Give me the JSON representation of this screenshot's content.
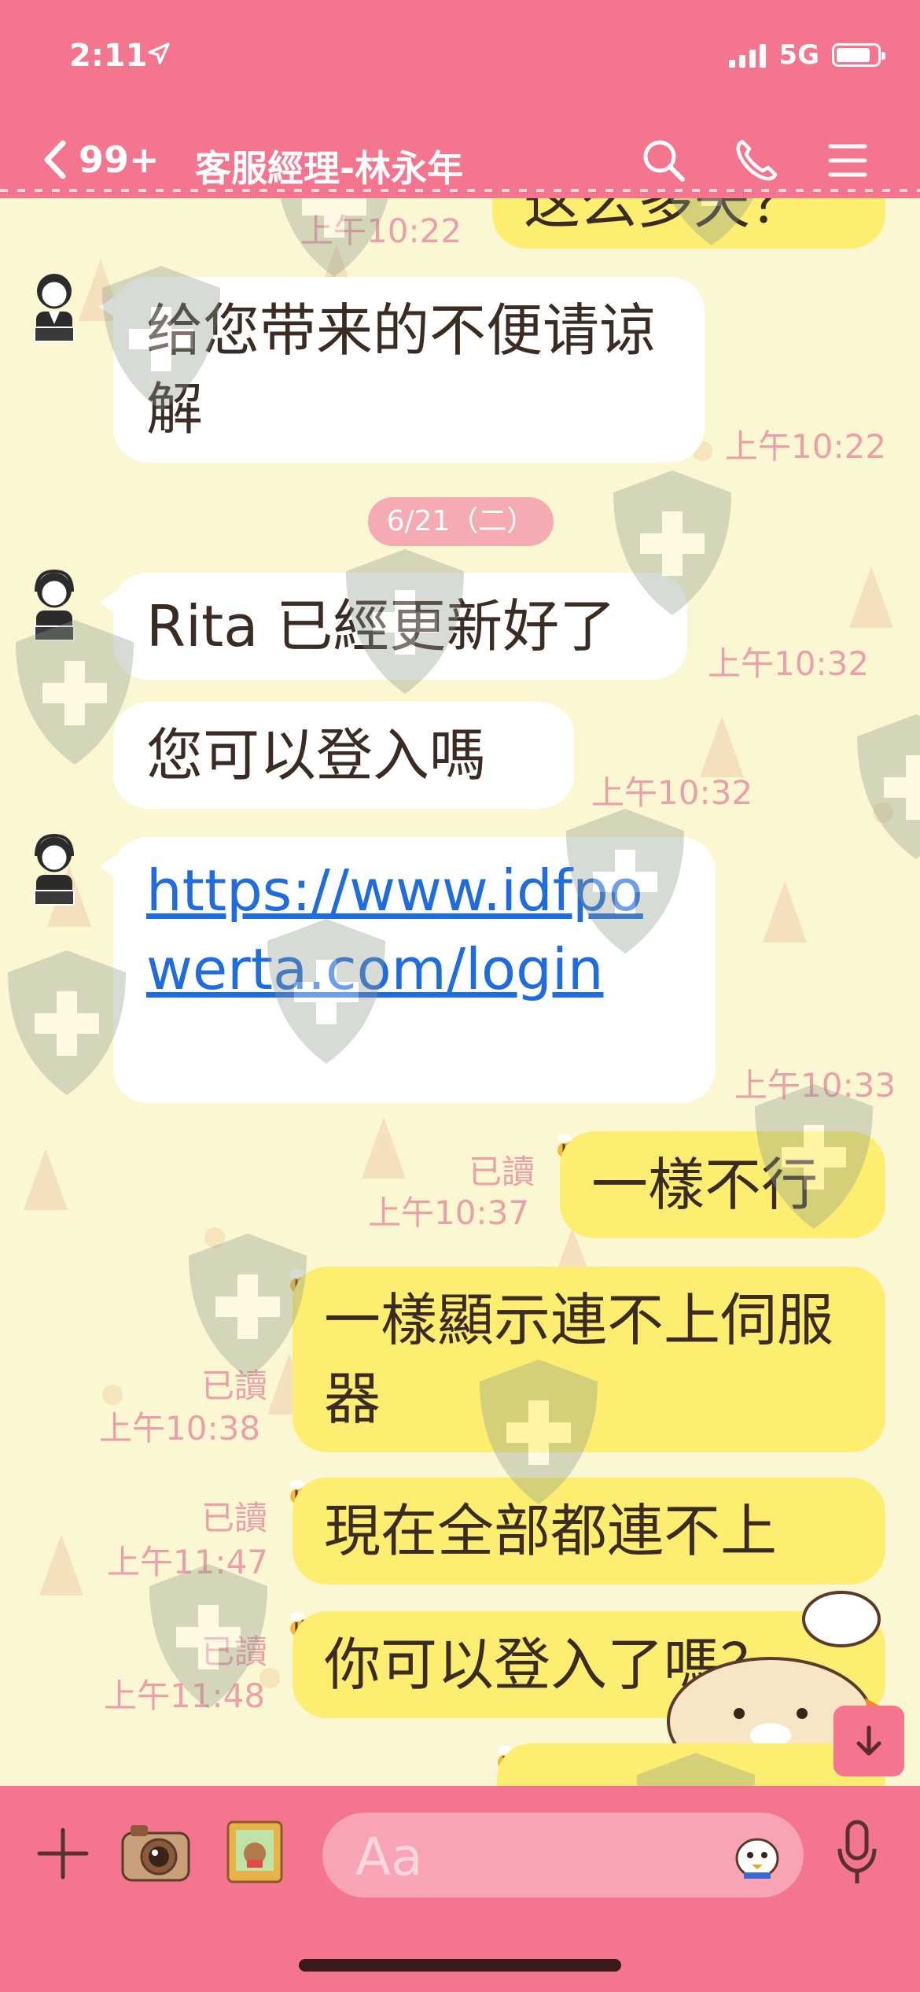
{
  "status_bar": {
    "time": "2:11",
    "network": "5G"
  },
  "header": {
    "back_label": "99+",
    "title": "客服經理-林永年"
  },
  "date_separator": "6/21（二）",
  "messages_in": [
    {
      "text": "给您带来的不便请谅解",
      "time": "上午10:22"
    },
    {
      "text": "Rita 已經更新好了",
      "time": "上午10:32"
    },
    {
      "text": "您可以登入嗎",
      "time": "上午10:32"
    },
    {
      "link": "https://www.idfpowerta.com/login",
      "time": "上午10:33"
    }
  ],
  "top_partial": {
    "text": "这么多天？",
    "time": "上午10:22"
  },
  "messages_out": [
    {
      "text": "一樣不行",
      "read": "已讀",
      "time": "上午10:37"
    },
    {
      "text": "一樣顯示連不上伺服器",
      "read": "已讀",
      "time": "上午10:38"
    },
    {
      "text": "現在全部都連不上",
      "read": "已讀",
      "time": "上午11:47"
    },
    {
      "text": "你可以登入了嗎？",
      "read": "已讀",
      "time": "上午11:48"
    }
  ],
  "input": {
    "placeholder": "Aa"
  },
  "colors": {
    "accent": "#f4758e",
    "bubble_out": "#fdee72",
    "bubble_in": "#ffffff",
    "link": "#1f6be0"
  }
}
